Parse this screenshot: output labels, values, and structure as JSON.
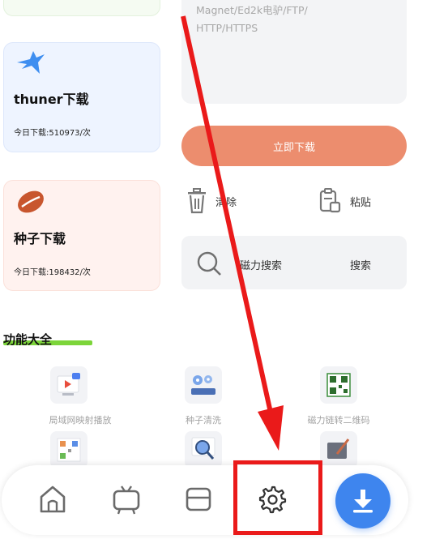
{
  "cards": [
    {
      "title": "thuner下载",
      "stat": "今日下载:510973/次",
      "icon": "bird-icon"
    },
    {
      "title": "种子下载",
      "stat": "今日下载:198432/次",
      "icon": "seed-icon"
    }
  ],
  "input": {
    "placeholder": "Magnet/Ed2k电驴/FTP/\nHTTP/HTTPS"
  },
  "download_button": "立即下载",
  "actions": {
    "clear": "清除",
    "paste": "粘贴"
  },
  "search": {
    "placeholder": "磁力搜索",
    "button": "搜索"
  },
  "functions": {
    "title": "功能大全",
    "items": [
      {
        "label": "局域网映射播放",
        "icon": "cast-play-icon"
      },
      {
        "label": "种子清洗",
        "icon": "gears-icon"
      },
      {
        "label": "磁力链转二维码",
        "icon": "qr-code-icon"
      },
      {
        "label": "",
        "icon": "qr-code-icon"
      },
      {
        "label": "",
        "icon": "magnifier-icon"
      },
      {
        "label": "",
        "icon": "brush-icon"
      }
    ]
  },
  "nav": [
    {
      "name": "home-icon"
    },
    {
      "name": "tv-icon"
    },
    {
      "name": "cards-icon"
    },
    {
      "name": "gear-icon"
    },
    {
      "name": "download-arrow-icon"
    }
  ],
  "colors": {
    "accent_orange": "#ec8d6e",
    "fab_blue": "#3e85ee",
    "highlight_red": "#ea1a1a",
    "underline_green": "#7cd53a"
  }
}
